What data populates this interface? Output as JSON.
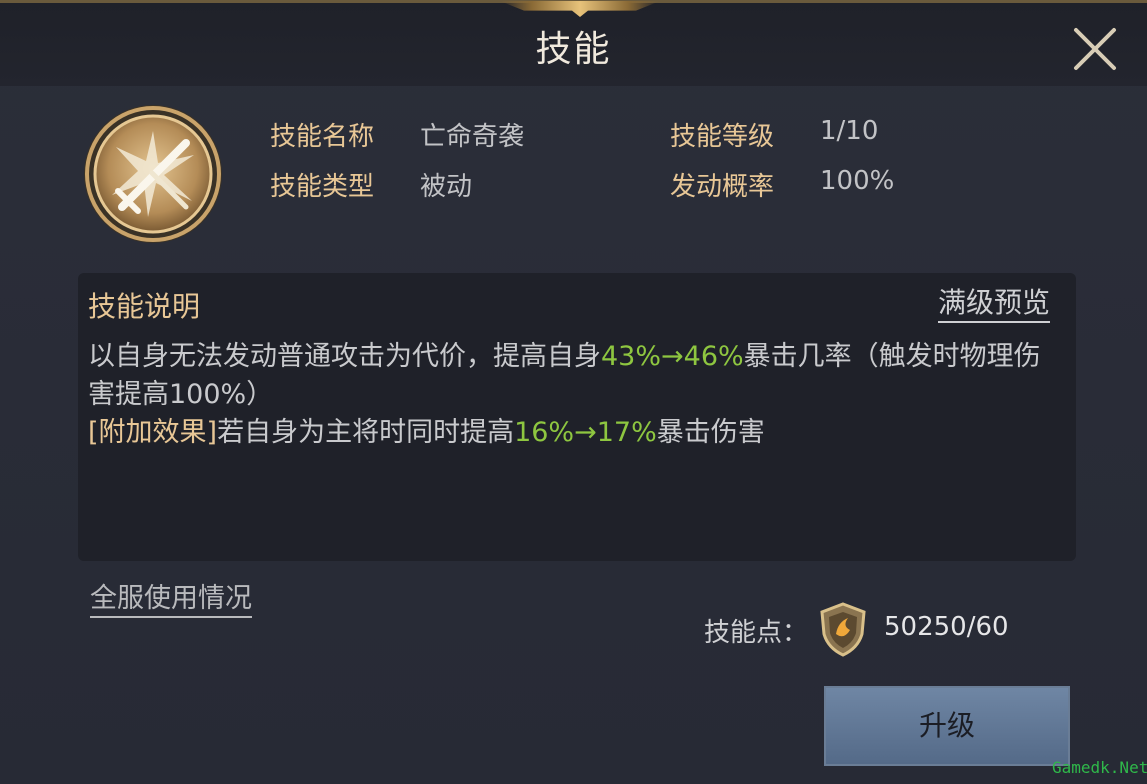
{
  "header": {
    "title": "技能"
  },
  "skill": {
    "icon": "crossed-swords-icon",
    "fields": [
      {
        "label": "技能名称",
        "value": "亡命奇袭"
      },
      {
        "label": "技能等级",
        "value": "1/10"
      },
      {
        "label": "技能类型",
        "value": "被动"
      },
      {
        "label": "发动概率",
        "value": "100%"
      }
    ]
  },
  "description": {
    "heading": "技能说明",
    "preview_link": "满级预览",
    "line1_a": "以自身无法发动普通攻击为代价，提高自身",
    "line1_green": "43%→46%",
    "line1_b": "暴击几率（触发时物理伤害提高100%）",
    "line2_tag": "[附加效果]",
    "line2_a": "若自身为主将时同时提高",
    "line2_green": "16%→17%",
    "line2_b": "暴击伤害"
  },
  "usage_link": "全服使用情况",
  "points": {
    "label": "技能点：",
    "icon": "shield-icon",
    "value": "50250/60"
  },
  "upgrade_button": "升级",
  "watermark": "Gamedk.Net",
  "colors": {
    "gold": "#e8c796",
    "green": "#8ec640",
    "text": "#c9cacd",
    "button": "#6f86a4"
  }
}
